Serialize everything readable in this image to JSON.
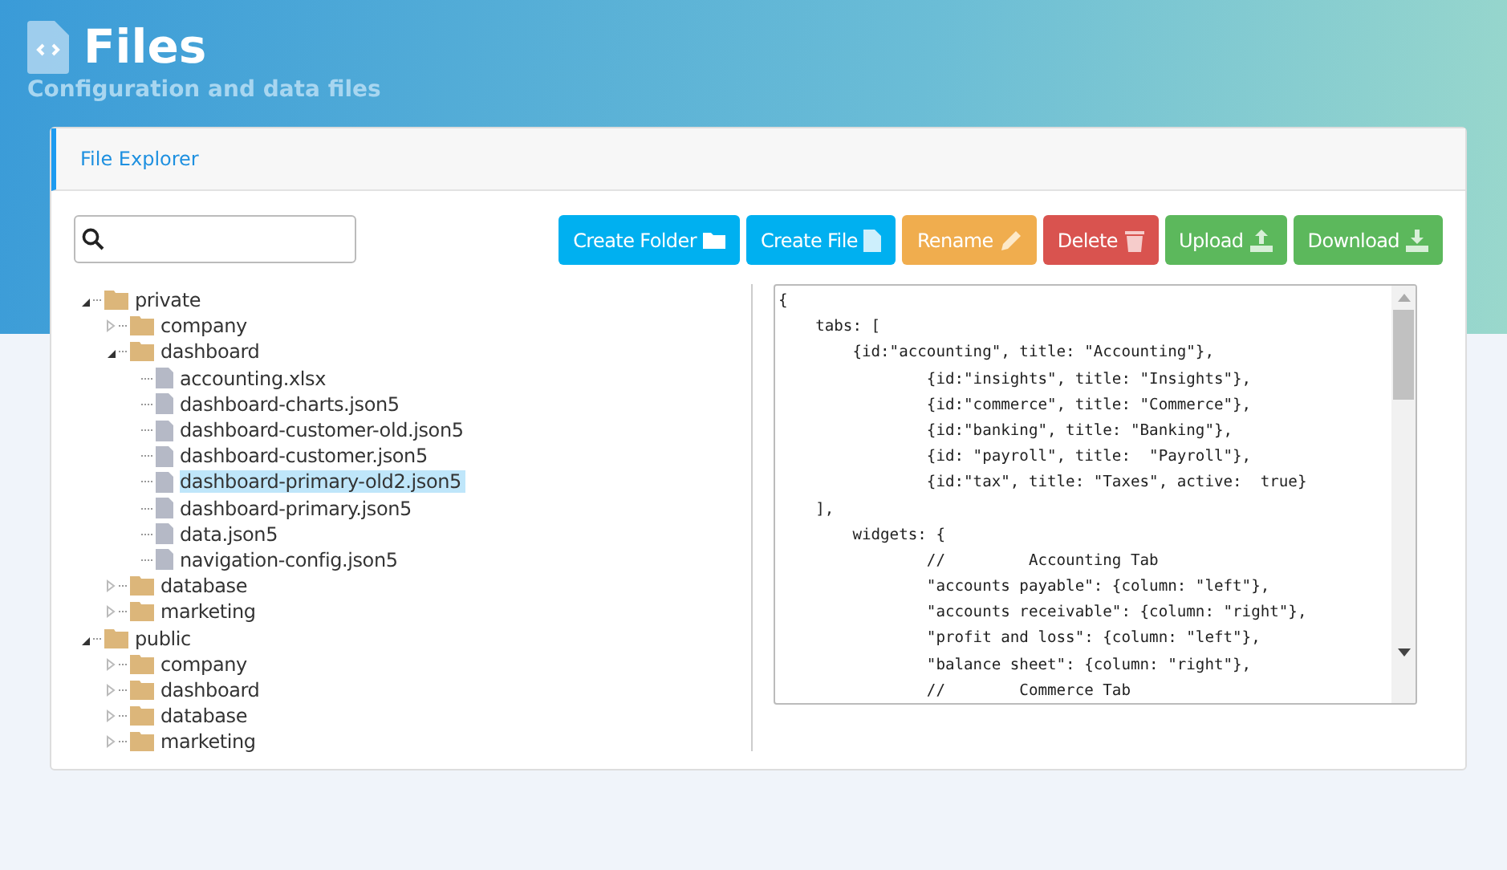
{
  "header": {
    "title": "Files",
    "subtitle": "Configuration and data files"
  },
  "panel": {
    "title": "File Explorer"
  },
  "buttons": [
    {
      "label": "Create Folder",
      "kind": "info"
    },
    {
      "label": "Create File",
      "kind": "info"
    },
    {
      "label": "Rename",
      "kind": "warning"
    },
    {
      "label": "Delete",
      "kind": "danger"
    },
    {
      "label": "Upload",
      "kind": "success"
    },
    {
      "label": "Download",
      "kind": "success"
    }
  ],
  "tree": [
    {
      "label": "private",
      "kind": "folder",
      "expanded": true,
      "selected": false,
      "children": [
        {
          "label": "company",
          "kind": "folder",
          "expanded": false,
          "selected": false
        },
        {
          "label": "dashboard",
          "kind": "folder",
          "expanded": true,
          "selected": false,
          "children": [
            {
              "label": "accounting.xlsx",
              "kind": "file",
              "selected": false
            },
            {
              "label": "dashboard-charts.json5",
              "kind": "file",
              "selected": false
            },
            {
              "label": "dashboard-customer-old.json5",
              "kind": "file",
              "selected": false
            },
            {
              "label": "dashboard-customer.json5",
              "kind": "file",
              "selected": false
            },
            {
              "label": "dashboard-primary-old2.json5",
              "kind": "file",
              "selected": true
            },
            {
              "label": "dashboard-primary.json5",
              "kind": "file",
              "selected": false
            },
            {
              "label": "data.json5",
              "kind": "file",
              "selected": false
            },
            {
              "label": "navigation-config.json5",
              "kind": "file",
              "selected": false
            }
          ]
        },
        {
          "label": "database",
          "kind": "folder",
          "expanded": false,
          "selected": false
        },
        {
          "label": "marketing",
          "kind": "folder",
          "expanded": false,
          "selected": false
        }
      ]
    },
    {
      "label": "public",
      "kind": "folder",
      "expanded": true,
      "selected": false,
      "children": [
        {
          "label": "company",
          "kind": "folder",
          "expanded": false,
          "selected": false
        },
        {
          "label": "dashboard",
          "kind": "folder",
          "expanded": false,
          "selected": false
        },
        {
          "label": "database",
          "kind": "folder",
          "expanded": false,
          "selected": false
        },
        {
          "label": "marketing",
          "kind": "folder",
          "expanded": false,
          "selected": false
        }
      ]
    }
  ],
  "editor": {
    "lines": [
      "{",
      "    tabs: [",
      "        {id:\"accounting\", title: \"Accounting\"},",
      "                {id:\"insights\", title: \"Insights\"},",
      "                {id:\"commerce\", title: \"Commerce\"},",
      "                {id:\"banking\", title: \"Banking\"},",
      "                {id: \"payroll\", title:  \"Payroll\"},",
      "                {id:\"tax\", title: \"Taxes\", active:  true}",
      "    ],",
      "        widgets: {",
      "                //         Accounting Tab",
      "                \"accounts payable\": {column: \"left\"},",
      "                \"accounts receivable\": {column: \"right\"},",
      "                \"profit and loss\": {column: \"left\"},",
      "                \"balance sheet\": {column: \"right\"},",
      "                //        Commerce Tab"
    ]
  }
}
